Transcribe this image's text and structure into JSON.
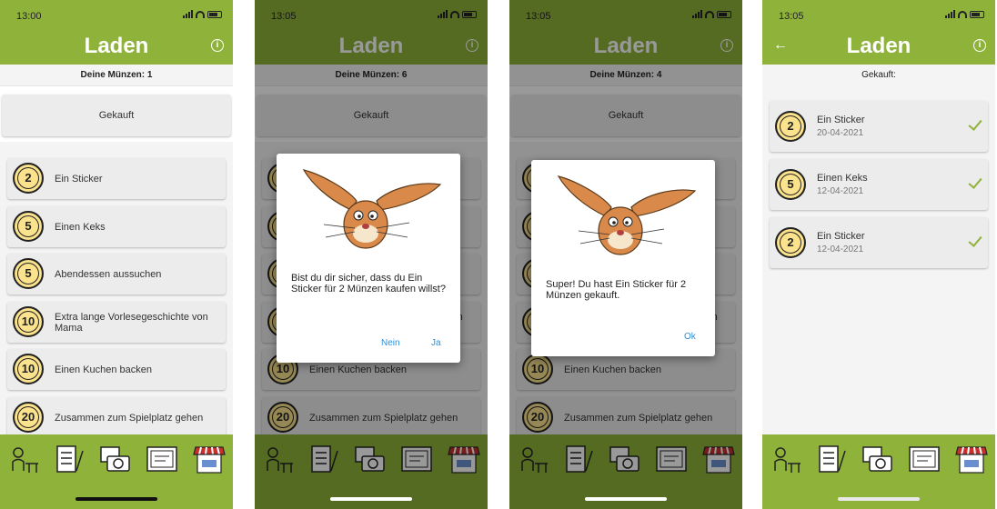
{
  "screens": [
    {
      "time": "13:00",
      "title": "Laden",
      "coins_label": "Deine Münzen: 1",
      "purchased_button": "Gekauft"
    },
    {
      "time": "13:05",
      "title": "Laden",
      "coins_label": "Deine Münzen: 6",
      "purchased_button": "Gekauft",
      "dialog": {
        "text": "Bist du dir sicher, dass du Ein Sticker für 2 Münzen kaufen willst?",
        "no": "Nein",
        "yes": "Ja"
      }
    },
    {
      "time": "13:05",
      "title": "Laden",
      "coins_label": "Deine Münzen: 4",
      "purchased_button": "Gekauft",
      "dialog": {
        "text": "Super! Du hast Ein Sticker für 2 Münzen gekauft.",
        "ok": "Ok"
      }
    },
    {
      "time": "13:05",
      "title": "Laden",
      "section_label": "Gekauft:"
    }
  ],
  "shop_items": [
    {
      "cost": "2",
      "label": "Ein Sticker"
    },
    {
      "cost": "5",
      "label": "Einen Keks"
    },
    {
      "cost": "5",
      "label": "Abendessen aussuchen"
    },
    {
      "cost": "10",
      "label": "Extra lange Vorlesegeschichte von Mama"
    },
    {
      "cost": "10",
      "label": "Einen Kuchen backen"
    },
    {
      "cost": "20",
      "label": "Zusammen zum Spielplatz gehen"
    }
  ],
  "purchased_items": [
    {
      "cost": "2",
      "label": "Ein Sticker",
      "date": "20-04-2021"
    },
    {
      "cost": "5",
      "label": "Einen Keks",
      "date": "12-04-2021"
    },
    {
      "cost": "2",
      "label": "Ein Sticker",
      "date": "12-04-2021"
    }
  ],
  "info_symbol": "i",
  "tabs": [
    "child-at-desk-icon",
    "checklist-icon",
    "photos-camera-icon",
    "certificate-icon",
    "shop-stall-icon"
  ],
  "colors": {
    "accent": "#8fb33a",
    "coin": "#fbe38d",
    "link": "#2a8fd8"
  }
}
